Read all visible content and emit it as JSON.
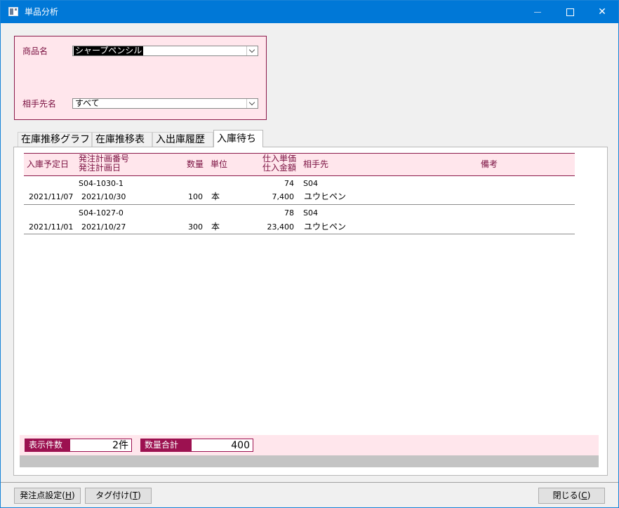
{
  "window": {
    "title": "単品分析",
    "icon": "app-window-icon"
  },
  "filters": {
    "product_label": "商品名",
    "product_value": "シャープペンシル",
    "partner_label": "相手先名",
    "partner_value": "すべて"
  },
  "tabs": [
    {
      "label": "在庫推移グラフ",
      "active": false
    },
    {
      "label": "在庫推移表",
      "active": false
    },
    {
      "label": "入出庫履歴",
      "active": false
    },
    {
      "label": "入庫待ち",
      "active": true
    }
  ],
  "grid": {
    "headers": {
      "due_date": "入庫予定日",
      "order_no": "発注計画番号",
      "order_date": "発注計画日",
      "qty": "数量",
      "unit": "単位",
      "unit_price": "仕入単価",
      "amount": "仕入金額",
      "partner": "相手先",
      "remarks": "備考"
    },
    "rows": [
      {
        "order_no": "S04-1030-1",
        "unit_price": "74",
        "partner_code": "S04",
        "due_date": "2021/11/07",
        "order_date": "2021/10/30",
        "qty": "100",
        "unit": "本",
        "amount": "7,400",
        "partner_name": "ユウヒペン"
      },
      {
        "order_no": "S04-1027-0",
        "unit_price": "78",
        "partner_code": "S04",
        "due_date": "2021/11/01",
        "order_date": "2021/10/27",
        "qty": "300",
        "unit": "本",
        "amount": "23,400",
        "partner_name": "ユウヒペン"
      }
    ]
  },
  "summary": {
    "count_label": "表示件数",
    "count_value": "2件",
    "qty_total_label": "数量合計",
    "qty_total_value": "400"
  },
  "buttons": {
    "reorder_point": {
      "text": "発注点設定(",
      "key": "H",
      "close": ")"
    },
    "tagging": {
      "text": "タグ付け(",
      "key": "T",
      "close": ")"
    },
    "close": {
      "text": "閉じる(",
      "key": "C",
      "close": ")"
    }
  },
  "colors": {
    "accent": "#9c1150",
    "panel_bg": "#ffe6ec",
    "titlebar": "#0078d7"
  }
}
